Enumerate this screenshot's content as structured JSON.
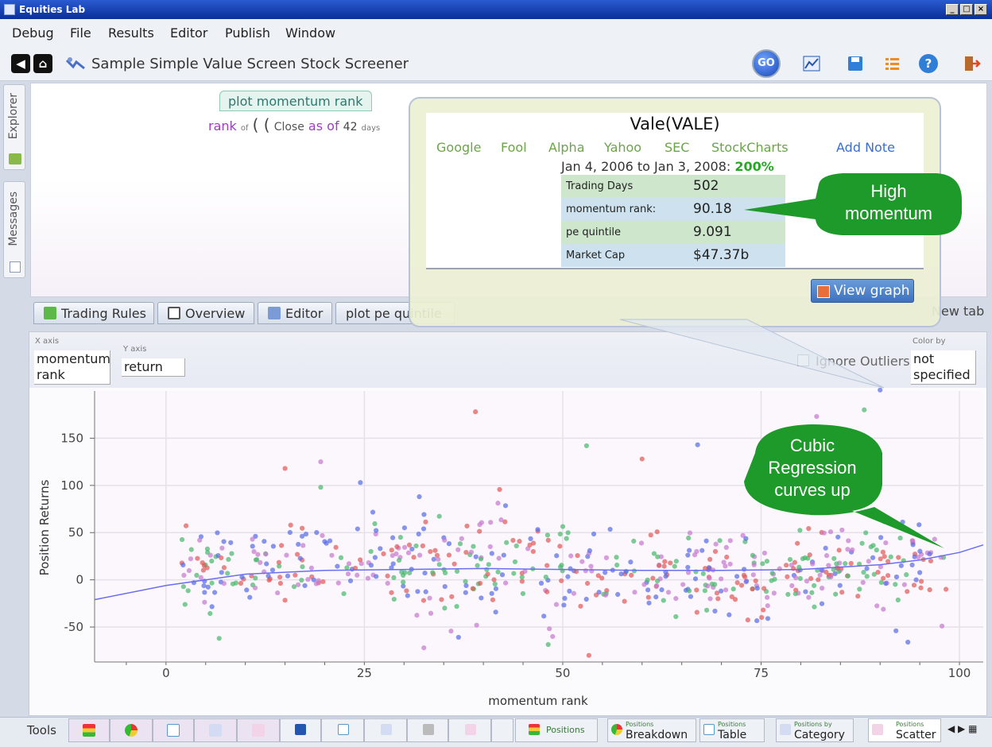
{
  "window": {
    "title": "Equities Lab",
    "controls": [
      "_",
      "□",
      "×"
    ]
  },
  "menu": [
    "Debug",
    "File",
    "Results",
    "Editor",
    "Publish",
    "Window"
  ],
  "toolbar": {
    "screen_title": "Sample Simple Value Screen Stock Screener",
    "go_label": "GO"
  },
  "side_tabs": {
    "explorer": "Explorer",
    "messages": "Messages"
  },
  "editor": {
    "plot_tag": "plot momentum rank",
    "rank": "rank",
    "of": "of",
    "open_parens": "( (",
    "close": "Close",
    "as_of": "as of",
    "days_value": "42",
    "days_label": "days"
  },
  "tabs": {
    "trading_rules": "Trading Rules",
    "overview": "Overview",
    "editor": "Editor",
    "plot_pe": "plot pe quintile",
    "new_tab": "New tab"
  },
  "popup": {
    "title": "Vale(VALE)",
    "links": [
      "Google",
      "Fool",
      "Alpha",
      "Yahoo",
      "SEC",
      "StockCharts"
    ],
    "add_note": "Add Note",
    "date_range": "Jan 4, 2006 to Jan 3, 2008:",
    "return_pct": "200%",
    "rows": [
      {
        "label": "Trading Days",
        "value": "502",
        "color": "#cde6cc"
      },
      {
        "label": "momentum rank:",
        "value": "90.18",
        "color": "#cde2ee"
      },
      {
        "label": "pe quintile",
        "value": "9.091",
        "color": "#cde6cc"
      },
      {
        "label": "Market Cap",
        "value": "$47.37b",
        "color": "#cde2ee"
      }
    ],
    "view_graph": "View graph"
  },
  "callouts": {
    "high_momentum": "High momentum",
    "cubic": "Cubic Regression curves up"
  },
  "scatter_controls": {
    "x_axis_label": "X axis",
    "x_axis_value": "momentum rank",
    "y_axis_label": "Y axis",
    "y_axis_value": "return",
    "ignore_outliers": "Ignore Outliers",
    "color_by_label": "Color by",
    "color_by_value": "not specified"
  },
  "chart_data": {
    "type": "scatter",
    "title": "",
    "xlabel": "momentum rank",
    "ylabel": "Position Returns",
    "xlim": [
      -9,
      103
    ],
    "ylim": [
      -87,
      200
    ],
    "xticks": [
      "0",
      "25",
      "50",
      "75",
      "100"
    ],
    "yticks": [
      "-50",
      "0",
      "50",
      "100",
      "150"
    ],
    "grid": true,
    "series_colors": [
      "#e25a5a",
      "#5a6ee8",
      "#4bb86e",
      "#c77ad0"
    ],
    "notable_points": [
      {
        "x": 39,
        "y": 178
      },
      {
        "x": 90,
        "y": 201
      },
      {
        "x": 88,
        "y": 180
      },
      {
        "x": 82,
        "y": 173
      },
      {
        "x": 60,
        "y": 128
      },
      {
        "x": 67,
        "y": 143
      },
      {
        "x": 53,
        "y": 142
      },
      {
        "x": 19.5,
        "y": 125
      },
      {
        "x": 15,
        "y": 118
      },
      {
        "x": 24.5,
        "y": 103
      },
      {
        "x": 19.5,
        "y": 98
      },
      {
        "x": 32.5,
        "y": -72
      },
      {
        "x": 53.3,
        "y": -80
      },
      {
        "x": 93.5,
        "y": -66
      },
      {
        "x": 6.7,
        "y": -62
      },
      {
        "x": 97.8,
        "y": -49
      },
      {
        "x": 98.3,
        "y": -10
      },
      {
        "x": 92,
        "y": -54
      }
    ],
    "regression": {
      "label": "cubic",
      "x": [
        -9,
        0,
        10,
        20,
        30,
        40,
        50,
        60,
        70,
        80,
        90,
        95,
        100,
        103
      ],
      "y": [
        -21,
        -6,
        6,
        10,
        11,
        12,
        11,
        10,
        10,
        11,
        16,
        21,
        29,
        37
      ]
    }
  },
  "bottom_bar": {
    "tools": "Tools",
    "positions_label": "Positions",
    "breakdown_small": "Positions",
    "breakdown": "Breakdown",
    "table_small": "Positions",
    "table": "Table",
    "category_small": "Positions by",
    "category": "Category",
    "scatter_small": "Positions",
    "scatter": "Scatter"
  }
}
